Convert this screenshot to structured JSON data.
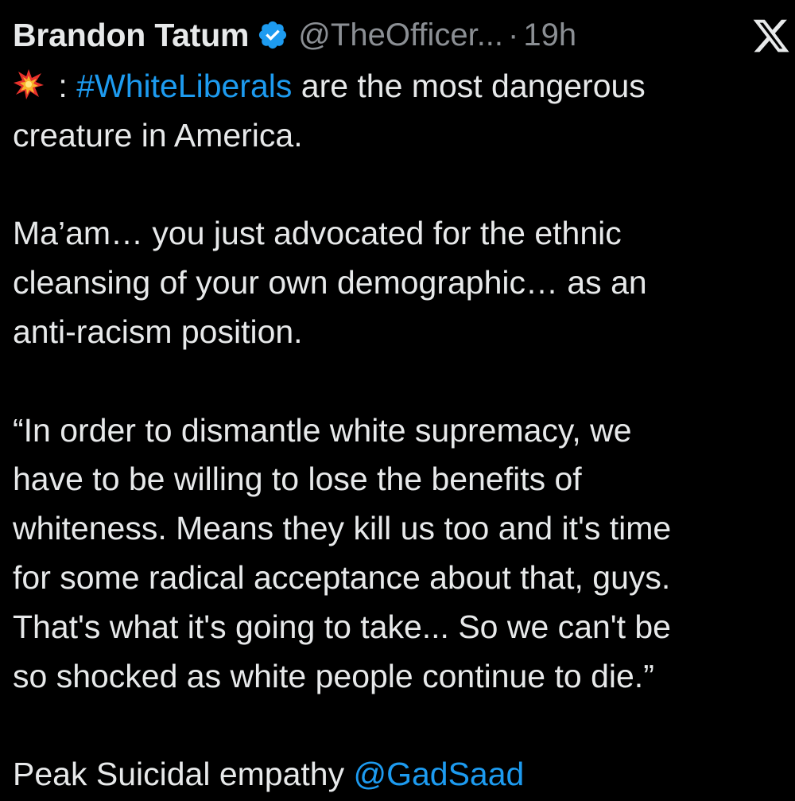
{
  "author": {
    "display_name": "Brandon Tatum",
    "handle": "@TheOfficer...",
    "separator": "·",
    "time": "19h"
  },
  "icons": {
    "verified": "verified-badge-icon",
    "platform": "x-logo-icon",
    "emoji": "collision-emoji-icon"
  },
  "colors": {
    "background": "#000000",
    "text": "#e7e9ea",
    "muted": "#8b8f94",
    "link": "#1d9bf0"
  },
  "tweet": {
    "p1": {
      "colon": " : ",
      "hashtag": "#WhiteLiberals",
      "l1_rest": " are the most dangerous",
      "l2": "creature in America."
    },
    "p2": {
      "l1": "Ma’am… you just advocated for the ethnic",
      "l2": "cleansing of your own demographic… as an",
      "l3": "anti-racism position."
    },
    "p3": {
      "l1": "“In order to dismantle white supremacy, we",
      "l2": "have to be willing to lose the benefits of",
      "l3": "whiteness. Means they kill us too and it's time",
      "l4": "for some radical acceptance about that, guys.",
      "l5": "That's what it's going to take... So we can't be",
      "l6": "so shocked as white people continue to die.”"
    },
    "p4": {
      "text": "Peak Suicidal empathy ",
      "mention": "@GadSaad"
    }
  }
}
